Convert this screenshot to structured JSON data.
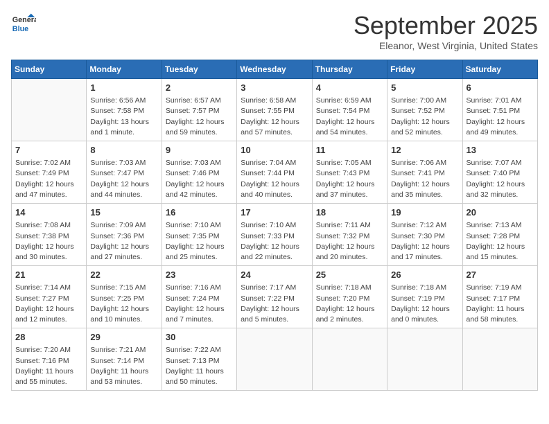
{
  "header": {
    "logo_line1": "General",
    "logo_line2": "Blue",
    "month": "September 2025",
    "location": "Eleanor, West Virginia, United States"
  },
  "days_of_week": [
    "Sunday",
    "Monday",
    "Tuesday",
    "Wednesday",
    "Thursday",
    "Friday",
    "Saturday"
  ],
  "weeks": [
    [
      {
        "num": "",
        "sunrise": "",
        "sunset": "",
        "daylight": ""
      },
      {
        "num": "1",
        "sunrise": "Sunrise: 6:56 AM",
        "sunset": "Sunset: 7:58 PM",
        "daylight": "Daylight: 13 hours and 1 minute."
      },
      {
        "num": "2",
        "sunrise": "Sunrise: 6:57 AM",
        "sunset": "Sunset: 7:57 PM",
        "daylight": "Daylight: 12 hours and 59 minutes."
      },
      {
        "num": "3",
        "sunrise": "Sunrise: 6:58 AM",
        "sunset": "Sunset: 7:55 PM",
        "daylight": "Daylight: 12 hours and 57 minutes."
      },
      {
        "num": "4",
        "sunrise": "Sunrise: 6:59 AM",
        "sunset": "Sunset: 7:54 PM",
        "daylight": "Daylight: 12 hours and 54 minutes."
      },
      {
        "num": "5",
        "sunrise": "Sunrise: 7:00 AM",
        "sunset": "Sunset: 7:52 PM",
        "daylight": "Daylight: 12 hours and 52 minutes."
      },
      {
        "num": "6",
        "sunrise": "Sunrise: 7:01 AM",
        "sunset": "Sunset: 7:51 PM",
        "daylight": "Daylight: 12 hours and 49 minutes."
      }
    ],
    [
      {
        "num": "7",
        "sunrise": "Sunrise: 7:02 AM",
        "sunset": "Sunset: 7:49 PM",
        "daylight": "Daylight: 12 hours and 47 minutes."
      },
      {
        "num": "8",
        "sunrise": "Sunrise: 7:03 AM",
        "sunset": "Sunset: 7:47 PM",
        "daylight": "Daylight: 12 hours and 44 minutes."
      },
      {
        "num": "9",
        "sunrise": "Sunrise: 7:03 AM",
        "sunset": "Sunset: 7:46 PM",
        "daylight": "Daylight: 12 hours and 42 minutes."
      },
      {
        "num": "10",
        "sunrise": "Sunrise: 7:04 AM",
        "sunset": "Sunset: 7:44 PM",
        "daylight": "Daylight: 12 hours and 40 minutes."
      },
      {
        "num": "11",
        "sunrise": "Sunrise: 7:05 AM",
        "sunset": "Sunset: 7:43 PM",
        "daylight": "Daylight: 12 hours and 37 minutes."
      },
      {
        "num": "12",
        "sunrise": "Sunrise: 7:06 AM",
        "sunset": "Sunset: 7:41 PM",
        "daylight": "Daylight: 12 hours and 35 minutes."
      },
      {
        "num": "13",
        "sunrise": "Sunrise: 7:07 AM",
        "sunset": "Sunset: 7:40 PM",
        "daylight": "Daylight: 12 hours and 32 minutes."
      }
    ],
    [
      {
        "num": "14",
        "sunrise": "Sunrise: 7:08 AM",
        "sunset": "Sunset: 7:38 PM",
        "daylight": "Daylight: 12 hours and 30 minutes."
      },
      {
        "num": "15",
        "sunrise": "Sunrise: 7:09 AM",
        "sunset": "Sunset: 7:36 PM",
        "daylight": "Daylight: 12 hours and 27 minutes."
      },
      {
        "num": "16",
        "sunrise": "Sunrise: 7:10 AM",
        "sunset": "Sunset: 7:35 PM",
        "daylight": "Daylight: 12 hours and 25 minutes."
      },
      {
        "num": "17",
        "sunrise": "Sunrise: 7:10 AM",
        "sunset": "Sunset: 7:33 PM",
        "daylight": "Daylight: 12 hours and 22 minutes."
      },
      {
        "num": "18",
        "sunrise": "Sunrise: 7:11 AM",
        "sunset": "Sunset: 7:32 PM",
        "daylight": "Daylight: 12 hours and 20 minutes."
      },
      {
        "num": "19",
        "sunrise": "Sunrise: 7:12 AM",
        "sunset": "Sunset: 7:30 PM",
        "daylight": "Daylight: 12 hours and 17 minutes."
      },
      {
        "num": "20",
        "sunrise": "Sunrise: 7:13 AM",
        "sunset": "Sunset: 7:28 PM",
        "daylight": "Daylight: 12 hours and 15 minutes."
      }
    ],
    [
      {
        "num": "21",
        "sunrise": "Sunrise: 7:14 AM",
        "sunset": "Sunset: 7:27 PM",
        "daylight": "Daylight: 12 hours and 12 minutes."
      },
      {
        "num": "22",
        "sunrise": "Sunrise: 7:15 AM",
        "sunset": "Sunset: 7:25 PM",
        "daylight": "Daylight: 12 hours and 10 minutes."
      },
      {
        "num": "23",
        "sunrise": "Sunrise: 7:16 AM",
        "sunset": "Sunset: 7:24 PM",
        "daylight": "Daylight: 12 hours and 7 minutes."
      },
      {
        "num": "24",
        "sunrise": "Sunrise: 7:17 AM",
        "sunset": "Sunset: 7:22 PM",
        "daylight": "Daylight: 12 hours and 5 minutes."
      },
      {
        "num": "25",
        "sunrise": "Sunrise: 7:18 AM",
        "sunset": "Sunset: 7:20 PM",
        "daylight": "Daylight: 12 hours and 2 minutes."
      },
      {
        "num": "26",
        "sunrise": "Sunrise: 7:18 AM",
        "sunset": "Sunset: 7:19 PM",
        "daylight": "Daylight: 12 hours and 0 minutes."
      },
      {
        "num": "27",
        "sunrise": "Sunrise: 7:19 AM",
        "sunset": "Sunset: 7:17 PM",
        "daylight": "Daylight: 11 hours and 58 minutes."
      }
    ],
    [
      {
        "num": "28",
        "sunrise": "Sunrise: 7:20 AM",
        "sunset": "Sunset: 7:16 PM",
        "daylight": "Daylight: 11 hours and 55 minutes."
      },
      {
        "num": "29",
        "sunrise": "Sunrise: 7:21 AM",
        "sunset": "Sunset: 7:14 PM",
        "daylight": "Daylight: 11 hours and 53 minutes."
      },
      {
        "num": "30",
        "sunrise": "Sunrise: 7:22 AM",
        "sunset": "Sunset: 7:13 PM",
        "daylight": "Daylight: 11 hours and 50 minutes."
      },
      {
        "num": "",
        "sunrise": "",
        "sunset": "",
        "daylight": ""
      },
      {
        "num": "",
        "sunrise": "",
        "sunset": "",
        "daylight": ""
      },
      {
        "num": "",
        "sunrise": "",
        "sunset": "",
        "daylight": ""
      },
      {
        "num": "",
        "sunrise": "",
        "sunset": "",
        "daylight": ""
      }
    ]
  ]
}
